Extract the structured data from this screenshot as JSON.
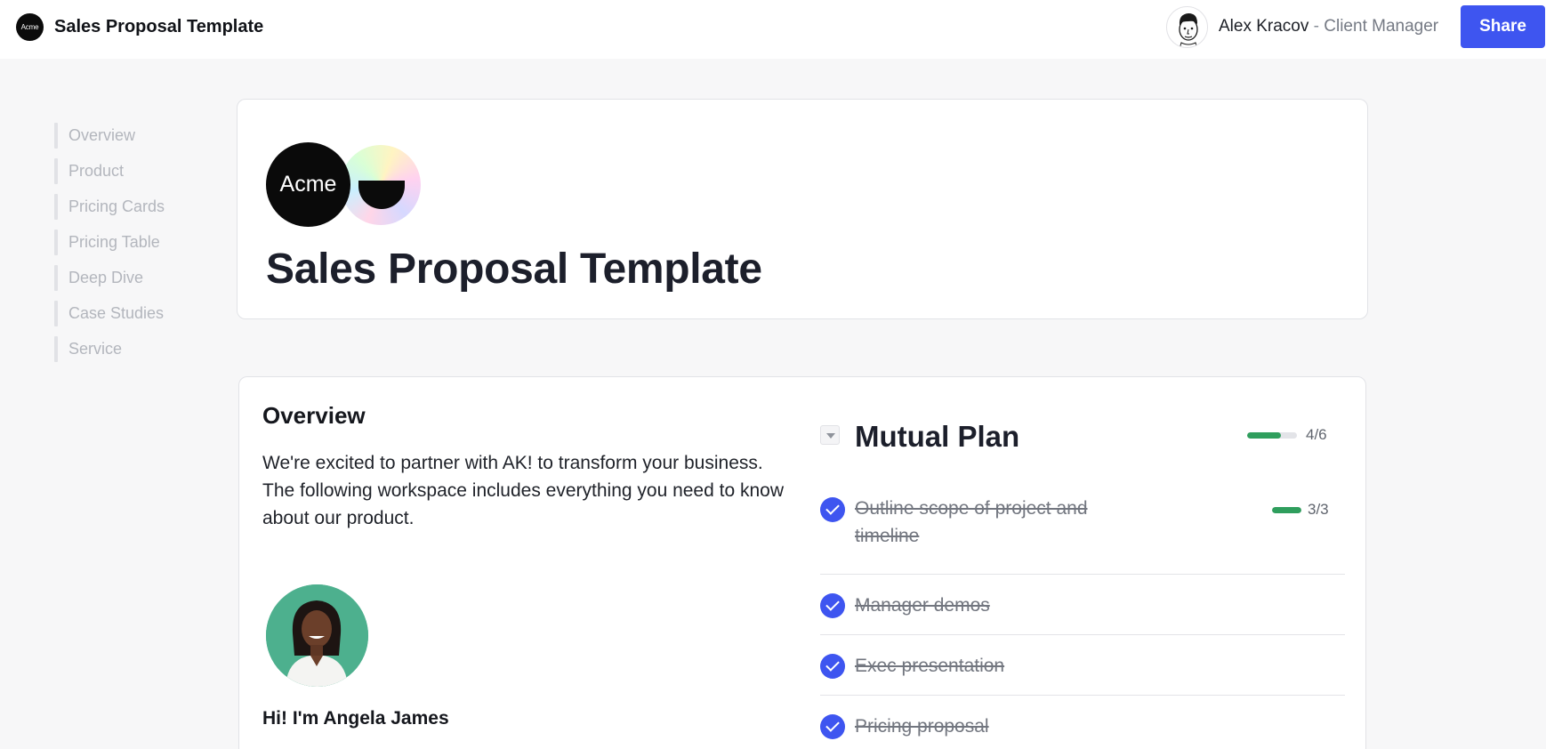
{
  "topbar": {
    "logo_text": "Acme",
    "title": "Sales Proposal Template",
    "user_name": "Alex Kracov",
    "user_separator": " - ",
    "user_role": "Client Manager",
    "share_label": "Share"
  },
  "sidebar": {
    "items": [
      {
        "label": "Overview"
      },
      {
        "label": "Product"
      },
      {
        "label": "Pricing Cards"
      },
      {
        "label": "Pricing Table"
      },
      {
        "label": "Deep Dive"
      },
      {
        "label": "Case Studies"
      },
      {
        "label": "Service"
      }
    ]
  },
  "hero": {
    "logo_text": "Acme",
    "title": "Sales Proposal Template"
  },
  "overview": {
    "heading": "Overview",
    "text": "We're excited to partner with AK! to transform your business. The following workspace includes everything you need to know about our product.",
    "rep_greeting": "Hi! I'm Angela James"
  },
  "mutual_plan": {
    "title": "Mutual Plan",
    "progress_label": "4/6",
    "progress_fraction": 0.67,
    "tasks": [
      {
        "label": "Outline scope of project and timeline",
        "done": true,
        "sub_progress_label": "3/3",
        "sub_progress_fraction": 1.0
      },
      {
        "label": "Manager demos",
        "done": true
      },
      {
        "label": "Exec presentation",
        "done": true
      },
      {
        "label": "Pricing proposal",
        "done": true
      }
    ]
  },
  "colors": {
    "accent": "#3e55f0",
    "progress": "#2f9e5d"
  }
}
